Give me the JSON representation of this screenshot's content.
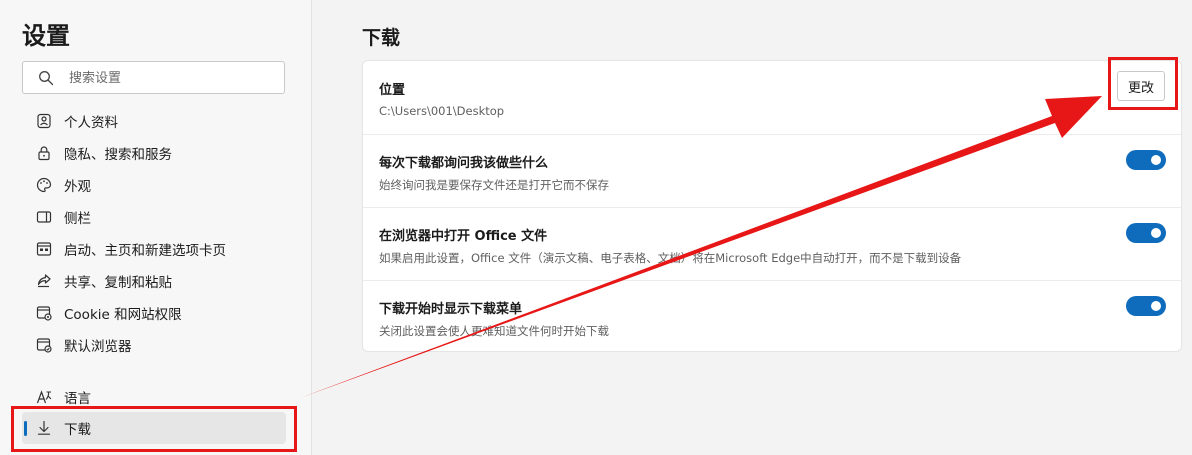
{
  "sidebar": {
    "title": "设置",
    "search_placeholder": "搜索设置",
    "items": [
      {
        "label": "个人资料"
      },
      {
        "label": "隐私、搜索和服务"
      },
      {
        "label": "外观"
      },
      {
        "label": "侧栏"
      },
      {
        "label": "启动、主页和新建选项卡页"
      },
      {
        "label": "共享、复制和粘贴"
      },
      {
        "label": "Cookie 和网站权限"
      },
      {
        "label": "默认浏览器"
      },
      {
        "label": "语言"
      },
      {
        "label": "下载"
      }
    ],
    "active_item": "下载"
  },
  "main": {
    "title": "下载",
    "location": {
      "title": "位置",
      "path": "C:\\Users\\001\\Desktop",
      "button_label": "更改"
    },
    "rows": [
      {
        "title": "每次下载都询问我该做些什么",
        "description": "始终询问我是要保存文件还是打开它而不保存",
        "enabled": true
      },
      {
        "title": "在浏览器中打开 Office 文件",
        "description": "如果启用此设置，Office 文件（演示文稿、电子表格、文档）将在Microsoft Edge中自动打开，而不是下载到设备",
        "enabled": true
      },
      {
        "title": "下载开始时显示下载菜单",
        "description": "关闭此设置会使人更难知道文件何时开始下载",
        "enabled": true
      }
    ]
  },
  "colors": {
    "accent": "#0f6cbd",
    "annotation": "#e81717"
  }
}
